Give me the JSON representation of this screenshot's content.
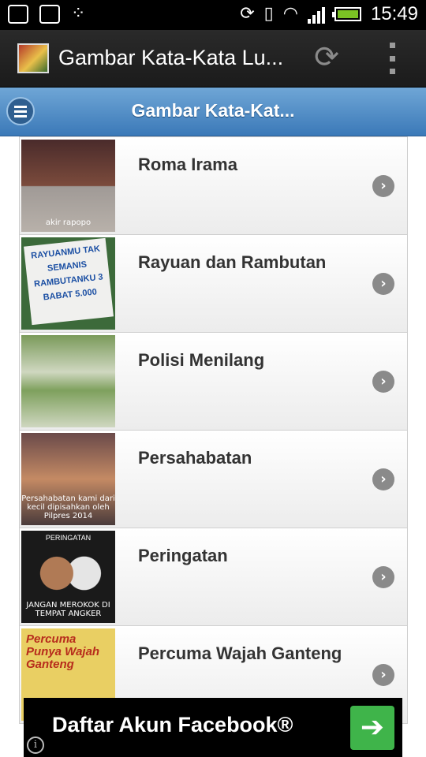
{
  "status_bar": {
    "time": "15:49",
    "icons": [
      "screenshot-icon",
      "gallery-icon",
      "blackberry-icon",
      "sync-icon",
      "vibrate-icon",
      "wifi-icon",
      "signal-icon",
      "battery-icon"
    ]
  },
  "action_bar": {
    "title": "Gambar Kata-Kata Lu...",
    "icons": [
      "app-icon",
      "refresh-icon",
      "overflow-menu-icon"
    ]
  },
  "header": {
    "title": "Gambar Kata-Kat..."
  },
  "list": {
    "items": [
      {
        "title": "Roma Irama",
        "thumb_caption": "akir rapopo"
      },
      {
        "title": "Rayuan dan Rambutan",
        "thumb_caption": "RAYUANMU TAK SEMANIS RAMBUTANKU 3 BABAT 5.000"
      },
      {
        "title": "Polisi Menilang",
        "thumb_caption": ""
      },
      {
        "title": "Persahabatan",
        "thumb_caption": "Persahabatan kami dari kecil dipisahkan oleh Pilpres 2014"
      },
      {
        "title": "Peringatan",
        "thumb_caption": "JANGAN MEROKOK DI TEMPAT ANGKER",
        "thumb_top": "PERINGATAN"
      },
      {
        "title": "Percuma Wajah Ganteng",
        "thumb_caption": "Percuma Punya Wajah Ganteng"
      }
    ]
  },
  "ad": {
    "text": "Daftar Akun Facebook®",
    "button_glyph": "➔",
    "info_glyph": "i"
  },
  "colors": {
    "header_blue": "#3b79b8",
    "ad_button_green": "#3fb44a"
  }
}
